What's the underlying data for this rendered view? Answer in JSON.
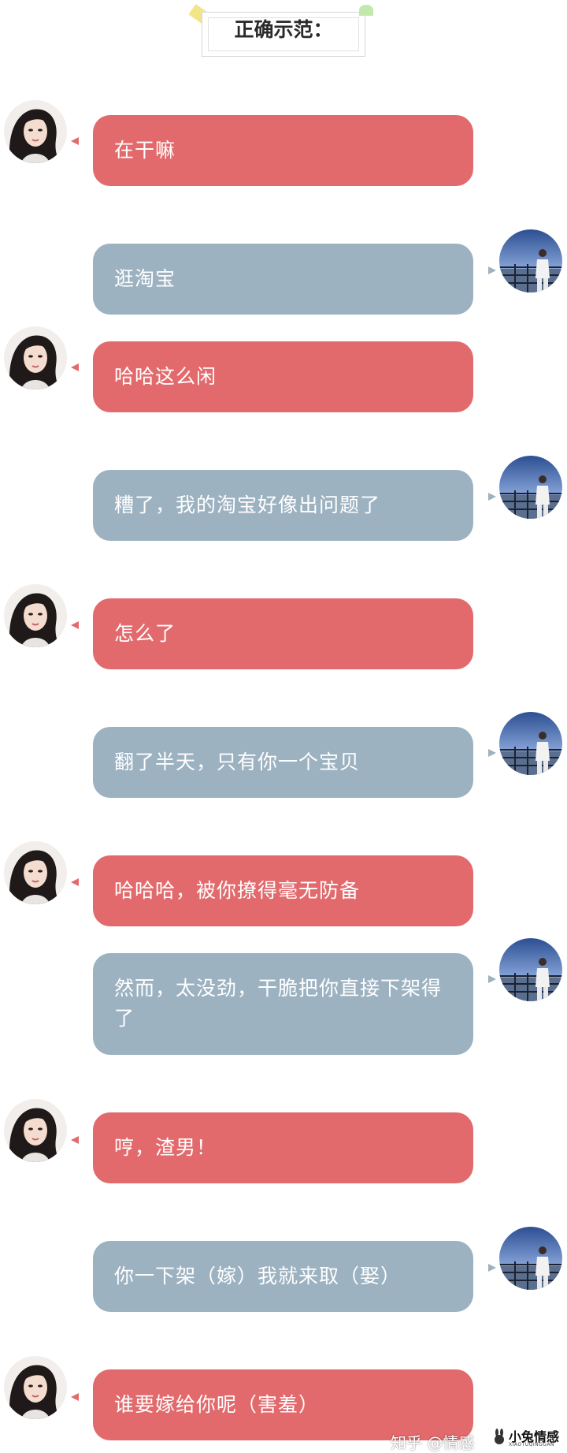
{
  "header": {
    "title": "正确示范："
  },
  "messages": [
    {
      "from": "her",
      "text": "在干嘛"
    },
    {
      "from": "him",
      "text": "逛淘宝"
    },
    {
      "from": "her",
      "text": "哈哈这么闲"
    },
    {
      "from": "him",
      "text": "糟了，我的淘宝好像出问题了"
    },
    {
      "from": "her",
      "text": "怎么了"
    },
    {
      "from": "him",
      "text": "翻了半天，只有你一个宝贝"
    },
    {
      "from": "her",
      "text": "哈哈哈，被你撩得毫无防备"
    },
    {
      "from": "him",
      "text": "然而，太没劲，干脆把你直接下架得了"
    },
    {
      "from": "her",
      "text": "哼，渣男！"
    },
    {
      "from": "him",
      "text": "你一下架（嫁）我就来取（娶）"
    },
    {
      "from": "her",
      "text": "谁要嫁给你呢（害羞）"
    }
  ],
  "watermark": {
    "text": "知乎 @情感",
    "brand": "小兔情感",
    "brand_sub": "XIAOTUQINGGAN"
  },
  "colors": {
    "her_bubble": "#e26a6c",
    "him_bubble": "#9db2c1"
  },
  "icons": {
    "her_avatar": "girl-avatar-icon",
    "him_avatar": "man-avatar-icon"
  }
}
